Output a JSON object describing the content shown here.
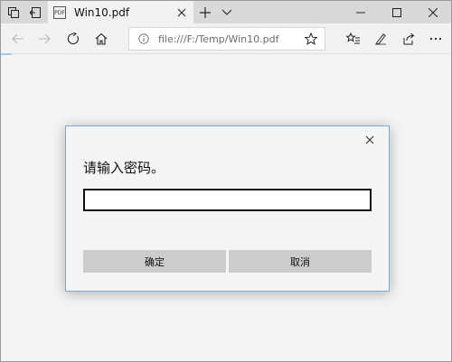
{
  "browser": {
    "tab": {
      "favicon_text": "PDF",
      "title": "Win10.pdf"
    },
    "address": {
      "url": "file:///F:/Temp/Win10.pdf"
    }
  },
  "dialog": {
    "prompt": "请输入密码。",
    "password_value": "",
    "ok_label": "确定",
    "cancel_label": "取消"
  },
  "colors": {
    "dialog_border": "#7ea9d6",
    "button_bg": "#cccccc",
    "tabbar_bg": "#d9d9d9"
  }
}
